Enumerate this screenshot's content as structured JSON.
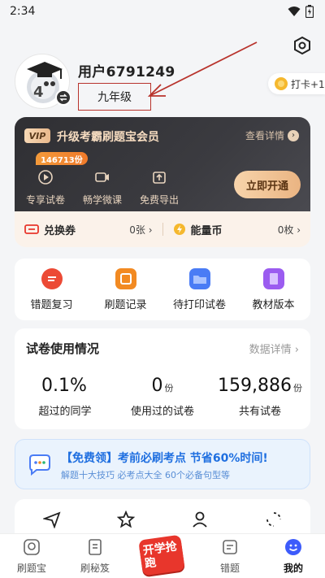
{
  "status": {
    "time": "2:34"
  },
  "profile": {
    "username": "用户6791249",
    "grade": "九年级"
  },
  "checkin": {
    "label": "打卡+1"
  },
  "vip": {
    "tag": "VIP",
    "title": "升级考霸刷题宝会员",
    "detail_label": "查看详情",
    "count_badge": "146713份",
    "perks": [
      "专享试卷",
      "畅学微课",
      "免费导出"
    ],
    "open_button": "立即开通",
    "voucher_label": "兑换券",
    "voucher_value": "0张",
    "energy_label": "能量币",
    "energy_value": "0枚"
  },
  "quick_actions": [
    "错题复习",
    "刷题记录",
    "待打印试卷",
    "教材版本"
  ],
  "usage": {
    "title": "试卷使用情况",
    "detail_link": "数据详情",
    "stats": [
      {
        "value": "0.1%",
        "unit": "",
        "label": "超过的同学"
      },
      {
        "value": "0",
        "unit": "份",
        "label": "使用过的试卷"
      },
      {
        "value": "159,886",
        "unit": "份",
        "label": "共有试卷"
      }
    ]
  },
  "promo": {
    "title": "【免费领】考前必刷考点 节省60%时间!",
    "subtitle": "解题十大技巧 必考点大全 60个必备句型等"
  },
  "tabbar": {
    "items": [
      "刷题宝",
      "刷秘笈",
      "开学抢跑",
      "错题",
      "我的"
    ],
    "active_index": 4
  },
  "colors": {
    "accent": "#f07a2a",
    "annotation": "#b8332c",
    "active_tab": "#3d5bfb"
  }
}
